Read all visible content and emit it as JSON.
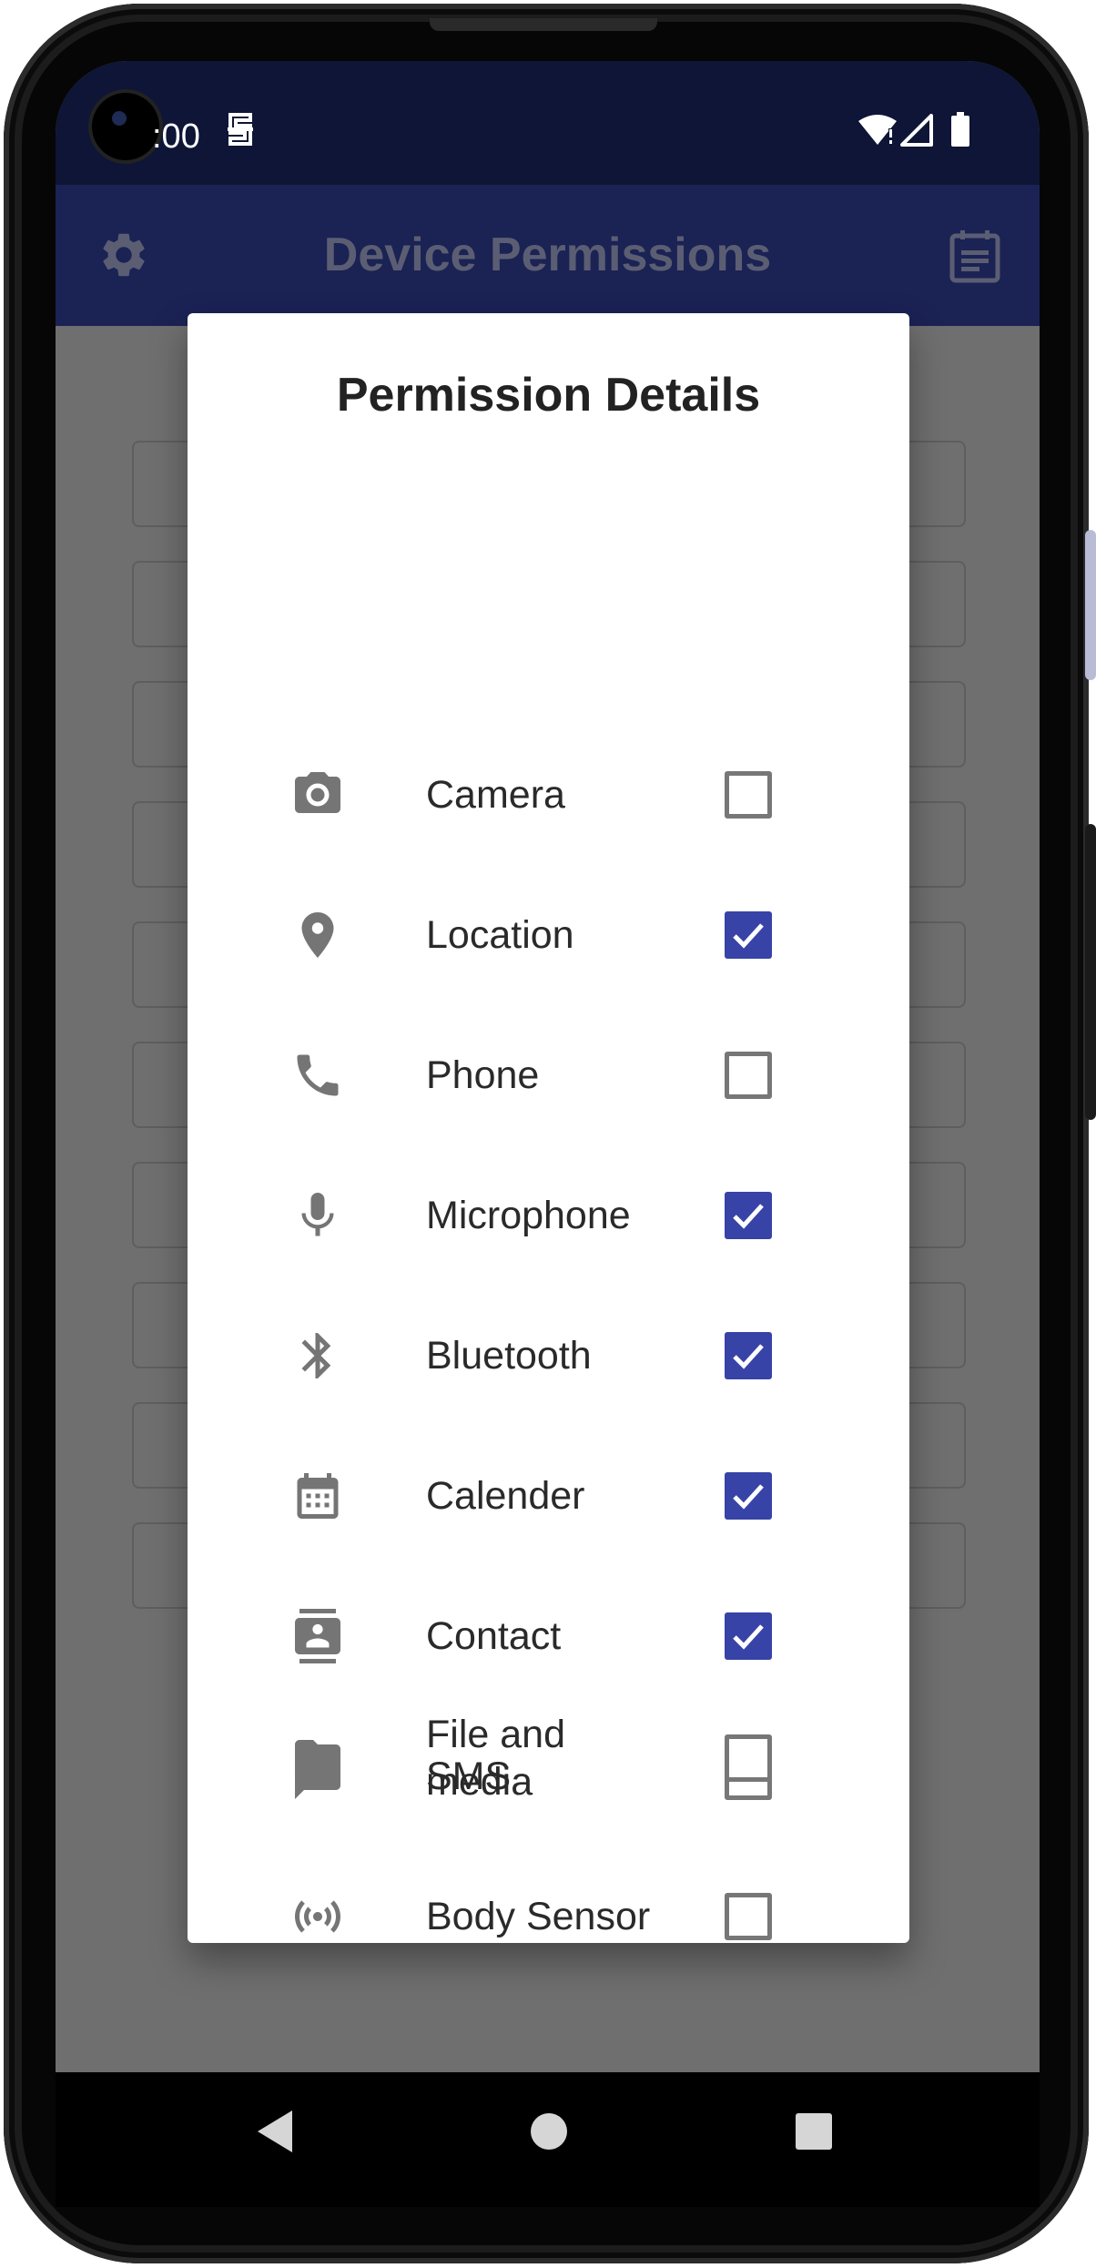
{
  "status_bar": {
    "time": ":00"
  },
  "app_bar": {
    "title": "Device Permissions"
  },
  "dialog": {
    "title": "Permission Details",
    "permissions": [
      {
        "label": "Camera",
        "icon": "camera-icon",
        "checked": false
      },
      {
        "label": "Location",
        "icon": "location-pin-icon",
        "checked": true
      },
      {
        "label": "Phone",
        "icon": "phone-icon",
        "checked": false
      },
      {
        "label": "Microphone",
        "icon": "microphone-icon",
        "checked": true
      },
      {
        "label": "Bluetooth",
        "icon": "bluetooth-icon",
        "checked": true
      },
      {
        "label": "Calender",
        "icon": "calendar-icon",
        "checked": true
      },
      {
        "label": "Contact",
        "icon": "contact-icon",
        "checked": true
      },
      {
        "label": "SMS",
        "icon": "sms-icon",
        "checked": false
      },
      {
        "label": "Body Sensor",
        "icon": "sensor-icon",
        "checked": false
      },
      {
        "label": "File and media",
        "icon": "folder-icon",
        "checked": false
      }
    ]
  },
  "colors": {
    "status_bar": "#0e1536",
    "app_bar": "#1b2254",
    "scrim": "#6f6f6f",
    "checkbox_checked": "#3743a6",
    "icon_gray": "#757575"
  }
}
